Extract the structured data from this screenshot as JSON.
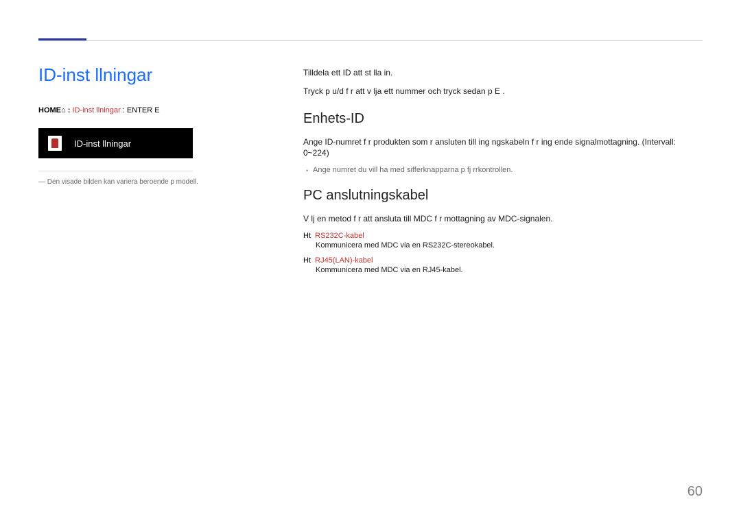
{
  "title": "ID-inst llningar",
  "breadcrumb": {
    "home": "HOME",
    "home_icon": "⌂",
    "sep": " : ",
    "current": "ID-inst llningar",
    "tail": " : ENTER E"
  },
  "ui_box_label": "ID-inst llningar",
  "footnote": "―  Den visade bilden kan variera beroende p  modell.",
  "intro1": "Tilldela ett ID att st lla in.",
  "intro2": "Tryck p  u/d f r att v lja ett nummer och tryck sedan p  E .",
  "section1": {
    "heading": "Enhets-ID",
    "body": "Ange ID-numret f r produkten som  r ansluten till ing ngskabeln f r ing ende signalmottagning. (Intervall: 0~224)",
    "note": "Ange numret du vill ha med sifferknapparna p  fj rrkontrollen."
  },
  "section2": {
    "heading": "PC anslutningskabel",
    "body": "V lj en metod f r att ansluta till MDC f r mottagning av MDC-signalen.",
    "options": [
      {
        "prefix": "Ht",
        "label": "RS232C-kabel",
        "desc": "Kommunicera med MDC via en RS232C-stereokabel."
      },
      {
        "prefix": "Ht",
        "label": "RJ45(LAN)-kabel",
        "desc": "Kommunicera med MDC via en RJ45-kabel."
      }
    ]
  },
  "page_number": "60"
}
